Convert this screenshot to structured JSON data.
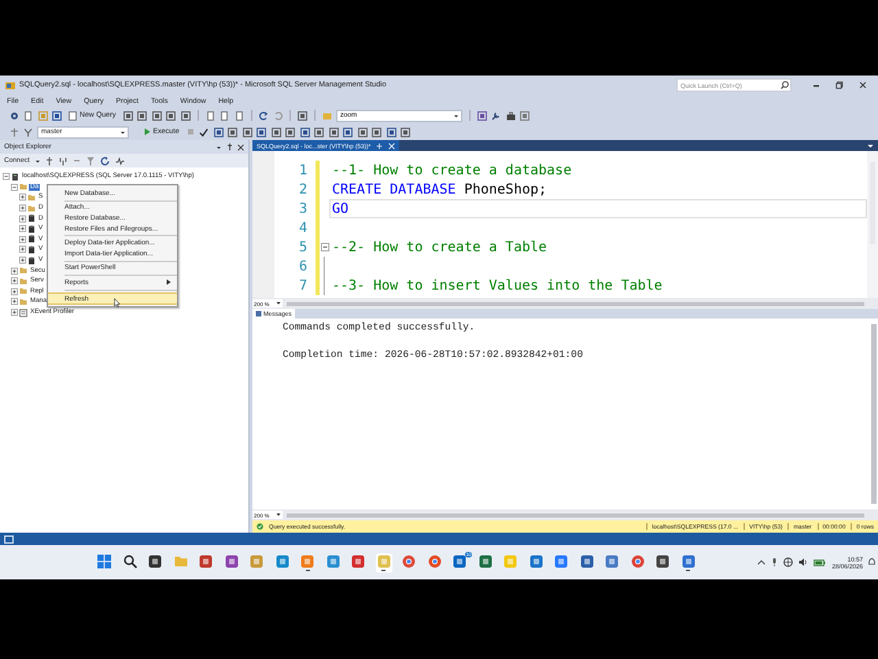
{
  "window": {
    "title": "SQLQuery2.sql - localhost\\SQLEXPRESS.master (VITY\\hp (53))* - Microsoft SQL Server Management Studio",
    "quick_launch": {
      "placeholder": "Quick Launch (Ctrl+Q)"
    }
  },
  "menu": [
    "File",
    "Edit",
    "View",
    "Query",
    "Project",
    "Tools",
    "Window",
    "Help"
  ],
  "toolbar": {
    "new_query": "New Query",
    "find": {
      "value": "zoom"
    },
    "database": "master",
    "execute": "Execute"
  },
  "object_explorer": {
    "title": "Object Explorer",
    "connect": "Connect",
    "tree": [
      {
        "label": "localhost\\SQLEXPRESS (SQL Server 17.0.1115 - VITY\\hp)",
        "kind": "server",
        "expanded": true,
        "selected": false,
        "children": [
          {
            "label": "Da",
            "kind": "folder",
            "expanded": true,
            "selected": true,
            "children": [
              {
                "label": "S",
                "kind": "folder",
                "expanded": false,
                "selected": false
              },
              {
                "label": "D",
                "kind": "folder",
                "expanded": false,
                "selected": false
              },
              {
                "label": "D",
                "kind": "database",
                "expanded": false,
                "selected": false
              },
              {
                "label": "V",
                "kind": "database",
                "expanded": false,
                "selected": false
              },
              {
                "label": "V",
                "kind": "database",
                "expanded": false,
                "selected": false
              },
              {
                "label": "V",
                "kind": "database",
                "expanded": false,
                "selected": false
              },
              {
                "label": "V",
                "kind": "database",
                "expanded": false,
                "selected": false
              }
            ]
          },
          {
            "label": "Secu",
            "kind": "folder",
            "expanded": false,
            "selected": false
          },
          {
            "label": "Serv",
            "kind": "folder",
            "expanded": false,
            "selected": false
          },
          {
            "label": "Repl",
            "kind": "folder",
            "expanded": false,
            "selected": false
          },
          {
            "label": "Mana",
            "kind": "folder",
            "expanded": false,
            "selected": false
          },
          {
            "label": "XEvent Profiler",
            "kind": "profiler",
            "expanded": false,
            "selected": false
          }
        ]
      }
    ]
  },
  "context_menu": [
    {
      "kind": "item",
      "label": "New Database...",
      "selected": false
    },
    {
      "kind": "separator"
    },
    {
      "kind": "item",
      "label": "Attach...",
      "selected": false
    },
    {
      "kind": "item",
      "label": "Restore Database...",
      "selected": false
    },
    {
      "kind": "item",
      "label": "Restore Files and Filegroups...",
      "selected": false
    },
    {
      "kind": "separator"
    },
    {
      "kind": "item",
      "label": "Deploy Data-tier Application...",
      "selected": false
    },
    {
      "kind": "item",
      "label": "Import Data-tier Application...",
      "selected": false
    },
    {
      "kind": "separator"
    },
    {
      "kind": "item",
      "label": "Start PowerShell",
      "selected": false
    },
    {
      "kind": "separator"
    },
    {
      "kind": "submenu",
      "label": "Reports",
      "selected": false
    },
    {
      "kind": "separator"
    },
    {
      "kind": "item",
      "label": "Refresh",
      "selected": true
    }
  ],
  "editor": {
    "tab": {
      "title": "SQLQuery2.sql - loc...ster (VITY\\hp (53))*",
      "selected": true
    },
    "zoom": "200 %",
    "lines": [
      {
        "number": "1",
        "current": false,
        "foldable": false,
        "in_fold": false,
        "tokens": [
          {
            "kind": "comment",
            "text": "--1- How to create a database"
          }
        ]
      },
      {
        "number": "2",
        "current": false,
        "foldable": false,
        "in_fold": false,
        "tokens": [
          {
            "kind": "keyword",
            "text": "CREATE DATABASE"
          },
          {
            "kind": "plain",
            "text": " PhoneShop;"
          }
        ]
      },
      {
        "number": "3",
        "current": true,
        "foldable": false,
        "in_fold": false,
        "tokens": [
          {
            "kind": "keyword",
            "text": "GO"
          }
        ]
      },
      {
        "number": "4",
        "current": false,
        "foldable": false,
        "in_fold": false
      },
      {
        "number": "5",
        "current": false,
        "foldable": true,
        "in_fold": false,
        "tokens": [
          {
            "kind": "comment",
            "text": "--2- How to create a Table"
          }
        ]
      },
      {
        "number": "6",
        "current": false,
        "foldable": false,
        "in_fold": true
      },
      {
        "number": "7",
        "current": false,
        "foldable": false,
        "in_fold": true,
        "tokens": [
          {
            "kind": "comment",
            "text": "--3- How to insert Values into the Table"
          }
        ]
      }
    ]
  },
  "results": {
    "tab": "Messages",
    "zoom": "200 %",
    "lines": [
      "Commands completed successfully.",
      "Completion time: 2026-06-28T10:57:02.8932842+01:00"
    ]
  },
  "status_bar": {
    "message": "Query executed successfully.",
    "cells": [
      "localhost\\SQLEXPRESS (17.0 ...",
      "VITY\\hp (53)",
      "master",
      "00:00:00",
      "0 rows"
    ]
  },
  "taskbar": {
    "apps": [
      {
        "running": false,
        "selected": false
      },
      {
        "running": false,
        "selected": false
      },
      {
        "running": false,
        "selected": false
      },
      {
        "running": false,
        "selected": false
      },
      {
        "running": false,
        "selected": false
      },
      {
        "running": false,
        "selected": false
      },
      {
        "running": false,
        "selected": false
      },
      {
        "running": false,
        "selected": false
      },
      {
        "running": true,
        "selected": false
      },
      {
        "running": false,
        "selected": false
      },
      {
        "running": false,
        "selected": false
      },
      {
        "running": true,
        "selected": true
      },
      {
        "running": false,
        "selected": false
      },
      {
        "running": false,
        "selected": false
      },
      {
        "running": false,
        "selected": false,
        "badge": "10"
      },
      {
        "running": false,
        "selected": false
      },
      {
        "running": false,
        "selected": false
      },
      {
        "running": false,
        "selected": false
      },
      {
        "running": false,
        "selected": false
      },
      {
        "running": false,
        "selected": false
      },
      {
        "running": false,
        "selected": false
      },
      {
        "running": false,
        "selected": false
      },
      {
        "running": false,
        "selected": false
      },
      {
        "running": true,
        "selected": false
      }
    ],
    "clock": {
      "time": "10:57",
      "date": "28/06/2026"
    }
  }
}
